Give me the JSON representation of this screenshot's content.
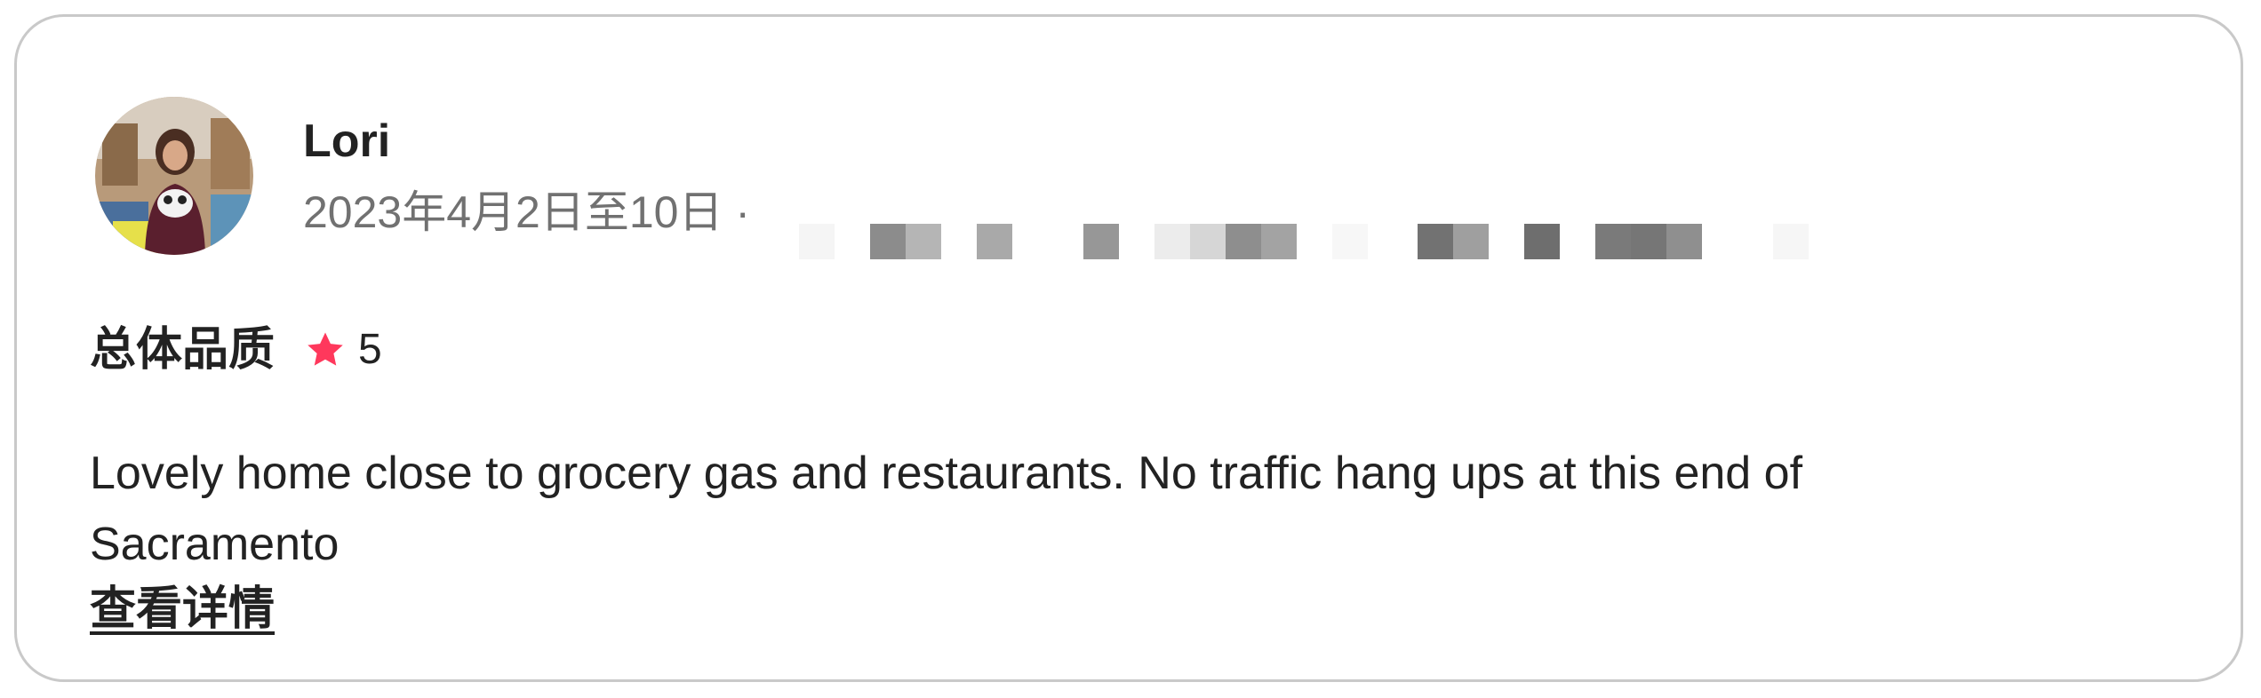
{
  "review": {
    "reviewer_name": "Lori",
    "date_text": "2023年4月2日至10日 ·",
    "rating_label": "总体品质",
    "rating_value": "5",
    "rating_icon": "star-icon",
    "rating_color": "#FF385C",
    "body": "Lovely home close to grocery gas and restaurants. No traffic hang ups at this end of Sacramento",
    "show_more_label": "查看详情"
  }
}
